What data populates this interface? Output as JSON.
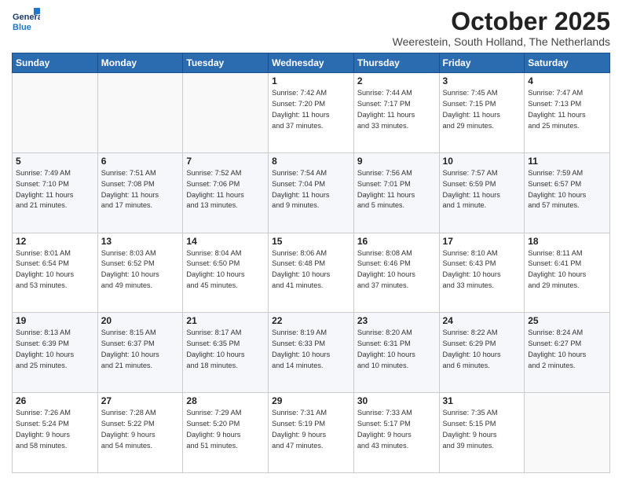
{
  "logo": {
    "line1": "General",
    "line2": "Blue"
  },
  "title": "October 2025",
  "location": "Weerestein, South Holland, The Netherlands",
  "weekdays": [
    "Sunday",
    "Monday",
    "Tuesday",
    "Wednesday",
    "Thursday",
    "Friday",
    "Saturday"
  ],
  "weeks": [
    [
      {
        "day": "",
        "info": ""
      },
      {
        "day": "",
        "info": ""
      },
      {
        "day": "",
        "info": ""
      },
      {
        "day": "1",
        "info": "Sunrise: 7:42 AM\nSunset: 7:20 PM\nDaylight: 11 hours\nand 37 minutes."
      },
      {
        "day": "2",
        "info": "Sunrise: 7:44 AM\nSunset: 7:17 PM\nDaylight: 11 hours\nand 33 minutes."
      },
      {
        "day": "3",
        "info": "Sunrise: 7:45 AM\nSunset: 7:15 PM\nDaylight: 11 hours\nand 29 minutes."
      },
      {
        "day": "4",
        "info": "Sunrise: 7:47 AM\nSunset: 7:13 PM\nDaylight: 11 hours\nand 25 minutes."
      }
    ],
    [
      {
        "day": "5",
        "info": "Sunrise: 7:49 AM\nSunset: 7:10 PM\nDaylight: 11 hours\nand 21 minutes."
      },
      {
        "day": "6",
        "info": "Sunrise: 7:51 AM\nSunset: 7:08 PM\nDaylight: 11 hours\nand 17 minutes."
      },
      {
        "day": "7",
        "info": "Sunrise: 7:52 AM\nSunset: 7:06 PM\nDaylight: 11 hours\nand 13 minutes."
      },
      {
        "day": "8",
        "info": "Sunrise: 7:54 AM\nSunset: 7:04 PM\nDaylight: 11 hours\nand 9 minutes."
      },
      {
        "day": "9",
        "info": "Sunrise: 7:56 AM\nSunset: 7:01 PM\nDaylight: 11 hours\nand 5 minutes."
      },
      {
        "day": "10",
        "info": "Sunrise: 7:57 AM\nSunset: 6:59 PM\nDaylight: 11 hours\nand 1 minute."
      },
      {
        "day": "11",
        "info": "Sunrise: 7:59 AM\nSunset: 6:57 PM\nDaylight: 10 hours\nand 57 minutes."
      }
    ],
    [
      {
        "day": "12",
        "info": "Sunrise: 8:01 AM\nSunset: 6:54 PM\nDaylight: 10 hours\nand 53 minutes."
      },
      {
        "day": "13",
        "info": "Sunrise: 8:03 AM\nSunset: 6:52 PM\nDaylight: 10 hours\nand 49 minutes."
      },
      {
        "day": "14",
        "info": "Sunrise: 8:04 AM\nSunset: 6:50 PM\nDaylight: 10 hours\nand 45 minutes."
      },
      {
        "day": "15",
        "info": "Sunrise: 8:06 AM\nSunset: 6:48 PM\nDaylight: 10 hours\nand 41 minutes."
      },
      {
        "day": "16",
        "info": "Sunrise: 8:08 AM\nSunset: 6:46 PM\nDaylight: 10 hours\nand 37 minutes."
      },
      {
        "day": "17",
        "info": "Sunrise: 8:10 AM\nSunset: 6:43 PM\nDaylight: 10 hours\nand 33 minutes."
      },
      {
        "day": "18",
        "info": "Sunrise: 8:11 AM\nSunset: 6:41 PM\nDaylight: 10 hours\nand 29 minutes."
      }
    ],
    [
      {
        "day": "19",
        "info": "Sunrise: 8:13 AM\nSunset: 6:39 PM\nDaylight: 10 hours\nand 25 minutes."
      },
      {
        "day": "20",
        "info": "Sunrise: 8:15 AM\nSunset: 6:37 PM\nDaylight: 10 hours\nand 21 minutes."
      },
      {
        "day": "21",
        "info": "Sunrise: 8:17 AM\nSunset: 6:35 PM\nDaylight: 10 hours\nand 18 minutes."
      },
      {
        "day": "22",
        "info": "Sunrise: 8:19 AM\nSunset: 6:33 PM\nDaylight: 10 hours\nand 14 minutes."
      },
      {
        "day": "23",
        "info": "Sunrise: 8:20 AM\nSunset: 6:31 PM\nDaylight: 10 hours\nand 10 minutes."
      },
      {
        "day": "24",
        "info": "Sunrise: 8:22 AM\nSunset: 6:29 PM\nDaylight: 10 hours\nand 6 minutes."
      },
      {
        "day": "25",
        "info": "Sunrise: 8:24 AM\nSunset: 6:27 PM\nDaylight: 10 hours\nand 2 minutes."
      }
    ],
    [
      {
        "day": "26",
        "info": "Sunrise: 7:26 AM\nSunset: 5:24 PM\nDaylight: 9 hours\nand 58 minutes."
      },
      {
        "day": "27",
        "info": "Sunrise: 7:28 AM\nSunset: 5:22 PM\nDaylight: 9 hours\nand 54 minutes."
      },
      {
        "day": "28",
        "info": "Sunrise: 7:29 AM\nSunset: 5:20 PM\nDaylight: 9 hours\nand 51 minutes."
      },
      {
        "day": "29",
        "info": "Sunrise: 7:31 AM\nSunset: 5:19 PM\nDaylight: 9 hours\nand 47 minutes."
      },
      {
        "day": "30",
        "info": "Sunrise: 7:33 AM\nSunset: 5:17 PM\nDaylight: 9 hours\nand 43 minutes."
      },
      {
        "day": "31",
        "info": "Sunrise: 7:35 AM\nSunset: 5:15 PM\nDaylight: 9 hours\nand 39 minutes."
      },
      {
        "day": "",
        "info": ""
      }
    ]
  ]
}
